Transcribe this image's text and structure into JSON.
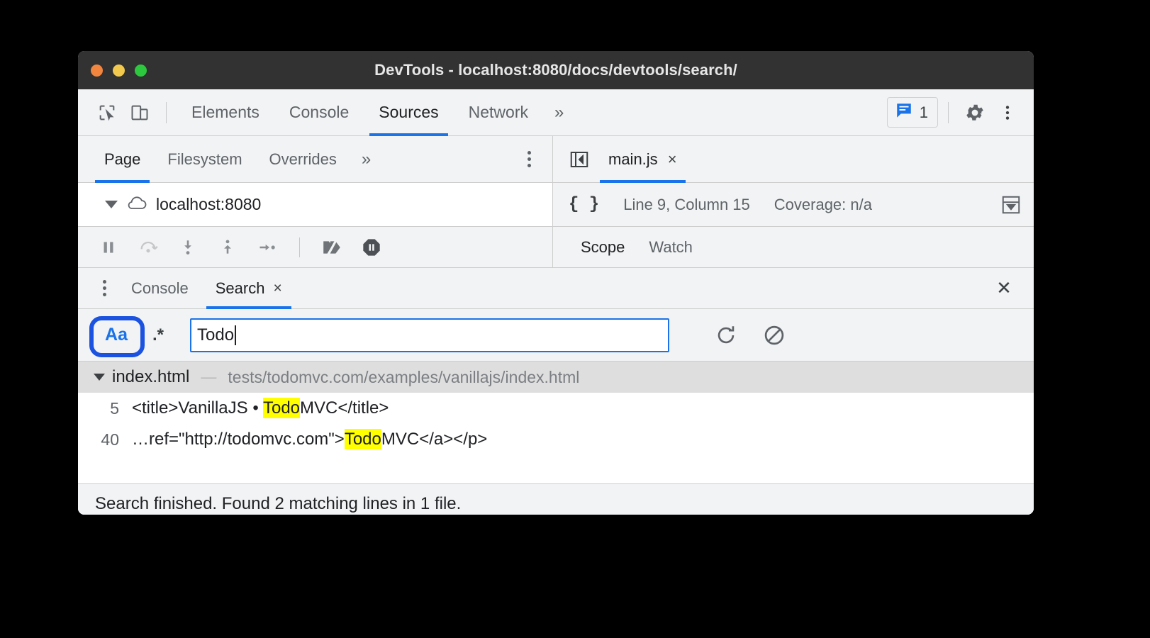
{
  "window": {
    "title": "DevTools - localhost:8080/docs/devtools/search/",
    "traffic_lights": [
      "close-button",
      "minimize-button",
      "maximize-button"
    ]
  },
  "main_toolbar": {
    "inspect_icon": "inspect-cursor-icon",
    "device_icon": "device-toolbar-icon",
    "tabs": [
      {
        "label": "Elements",
        "active": false
      },
      {
        "label": "Console",
        "active": false
      },
      {
        "label": "Sources",
        "active": true
      },
      {
        "label": "Network",
        "active": false
      }
    ],
    "more_tabs": "»",
    "message_count": "1",
    "message_icon": "message-bubble-icon",
    "settings_icon": "gear-icon",
    "more_icon": "kebab-menu-icon"
  },
  "navigator": {
    "tabs": [
      {
        "label": "Page",
        "active": true
      },
      {
        "label": "Filesystem",
        "active": false
      },
      {
        "label": "Overrides",
        "active": false
      }
    ],
    "more_tabs": "»",
    "menu_icon": "kebab-menu-icon",
    "tree": {
      "expander": "triangle-down-icon",
      "cloud_icon": "cloud-icon",
      "label": "localhost:8080"
    }
  },
  "editor": {
    "panel_toggle_icon": "show-navigator-icon",
    "tab_label": "main.js",
    "tab_close": "×",
    "format_icon": "{ }",
    "cursor_position": "Line 9, Column 15",
    "coverage": "Coverage: n/a",
    "coverage_dropdown_icon": "expand-down-icon"
  },
  "debugger_toolbar": {
    "icons": [
      "resume-pause-icon",
      "step-over-icon",
      "step-into-icon",
      "step-out-icon",
      "step-icon",
      "deactivate-breakpoints-icon",
      "pause-on-exceptions-icon"
    ]
  },
  "sidebar_panes": {
    "tabs": [
      {
        "label": "Scope",
        "active": true
      },
      {
        "label": "Watch",
        "active": false
      }
    ]
  },
  "drawer": {
    "menu_icon": "kebab-menu-icon",
    "tabs": [
      {
        "label": "Console",
        "active": false,
        "closable": false
      },
      {
        "label": "Search",
        "active": true,
        "closable": true,
        "close": "×"
      }
    ],
    "close_icon": "✕"
  },
  "search": {
    "match_case_label": "Aa",
    "match_case_active": true,
    "regex_label": ".*",
    "query": "Todo",
    "placeholder": "",
    "refresh_icon": "refresh-icon",
    "clear_icon": "clear-icon",
    "annotation_color": "#1b52e0"
  },
  "results": {
    "file": {
      "expander": "triangle-down-icon",
      "name": "index.html",
      "dash": "—",
      "path": "tests/todomvc.com/examples/vanillajs/index.html"
    },
    "matches": [
      {
        "line": "5",
        "before": "<title>VanillaJS • ",
        "hit": "Todo",
        "after": "MVC</title>"
      },
      {
        "line": "40",
        "before": "…ref=\"http://todomvc.com\">",
        "hit": "Todo",
        "after": "MVC</a></p>"
      }
    ],
    "highlight_color": "#ffff00"
  },
  "status": {
    "text": "Search finished.  Found 2 matching lines in 1 file."
  }
}
